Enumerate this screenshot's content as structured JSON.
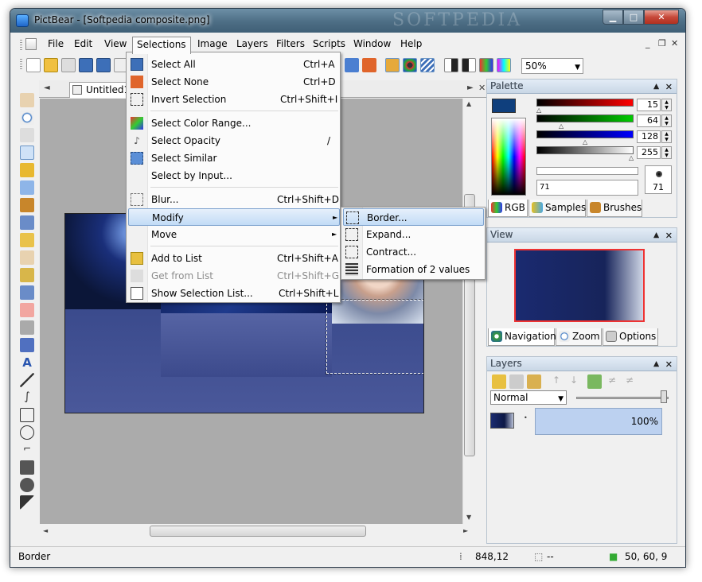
{
  "window": {
    "title": "PictBear - [Softpedia composite.png]",
    "watermark": "SOFTPEDIA"
  },
  "menubar": {
    "items": [
      "File",
      "Edit",
      "View",
      "Selections",
      "Image",
      "Layers",
      "Filters",
      "Scripts",
      "Window",
      "Help"
    ],
    "active": "Selections"
  },
  "toolbar": {
    "zoom": "50%"
  },
  "document": {
    "tab_label": "Untitled1"
  },
  "selections_menu": {
    "items": [
      {
        "label": "Select All",
        "shortcut": "Ctrl+A"
      },
      {
        "label": "Select None",
        "shortcut": "Ctrl+D"
      },
      {
        "label": "Invert Selection",
        "shortcut": "Ctrl+Shift+I"
      },
      {
        "label": "Select Color Range...",
        "shortcut": ""
      },
      {
        "label": "Select Opacity",
        "shortcut": "/"
      },
      {
        "label": "Select Similar",
        "shortcut": ""
      },
      {
        "label": "Select by Input...",
        "shortcut": ""
      },
      {
        "label": "Blur...",
        "shortcut": "Ctrl+Shift+D"
      },
      {
        "label": "Modify",
        "shortcut": ""
      },
      {
        "label": "Move",
        "shortcut": ""
      },
      {
        "label": "Add to List",
        "shortcut": "Ctrl+Shift+A"
      },
      {
        "label": "Get from List",
        "shortcut": "Ctrl+Shift+G"
      },
      {
        "label": "Show Selection List...",
        "shortcut": "Ctrl+Shift+L"
      }
    ]
  },
  "modify_submenu": {
    "items": [
      "Border...",
      "Expand...",
      "Contract...",
      "Formation of 2 values"
    ]
  },
  "palette": {
    "title": "Palette",
    "values": [
      "15",
      "64",
      "128",
      "255"
    ],
    "alpha_label": "71",
    "brush_size": "71",
    "tabs": [
      "RGB",
      "Samples",
      "Brushes"
    ]
  },
  "view_panel": {
    "title": "View",
    "tabs": [
      "Navigation",
      "Zoom",
      "Options"
    ]
  },
  "layers_panel": {
    "title": "Layers",
    "blend_mode": "Normal",
    "layer_opacity": "100%"
  },
  "status": {
    "text": "Border",
    "coords": "848,12",
    "selection": "--",
    "color": "50, 60, 9"
  },
  "colors": {
    "foreground": "#0f3f7d",
    "menu_highlight": "#c2dcf6",
    "selection_border": "#7da2ce"
  }
}
